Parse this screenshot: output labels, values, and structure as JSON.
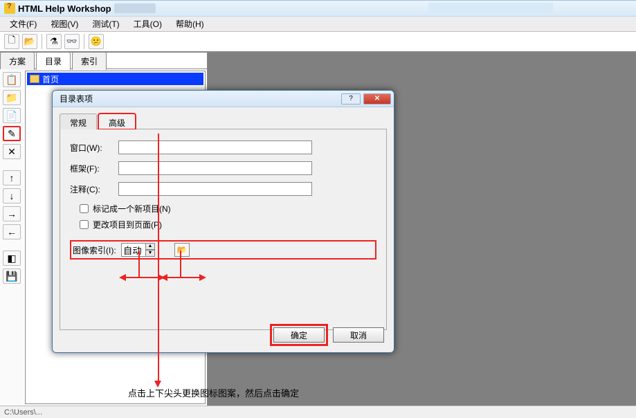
{
  "app": {
    "title": "HTML Help Workshop"
  },
  "menu": {
    "file": "文件(F)",
    "view": "视图(V)",
    "test": "测试(T)",
    "tools": "工具(O)",
    "help": "帮助(H)"
  },
  "tabs": {
    "project": "方案",
    "contents": "目录",
    "index": "索引"
  },
  "tree": {
    "root": "首页"
  },
  "dialog": {
    "title": "目录表项",
    "tab_general": "常规",
    "tab_advanced": "高级",
    "window_label": "窗口(W):",
    "frame_label": "框架(F):",
    "comment_label": "注释(C):",
    "mark_new": "标记成一个新项目(N)",
    "change_page": "更改项目到页面(P)",
    "image_index_label": "图像索引(I):",
    "image_index_value": "自动",
    "ok": "确定",
    "cancel": "取消"
  },
  "annotation": "点击上下尖头更换图标图案，然后点击确定",
  "statusbar": "C:\\Users\\..."
}
